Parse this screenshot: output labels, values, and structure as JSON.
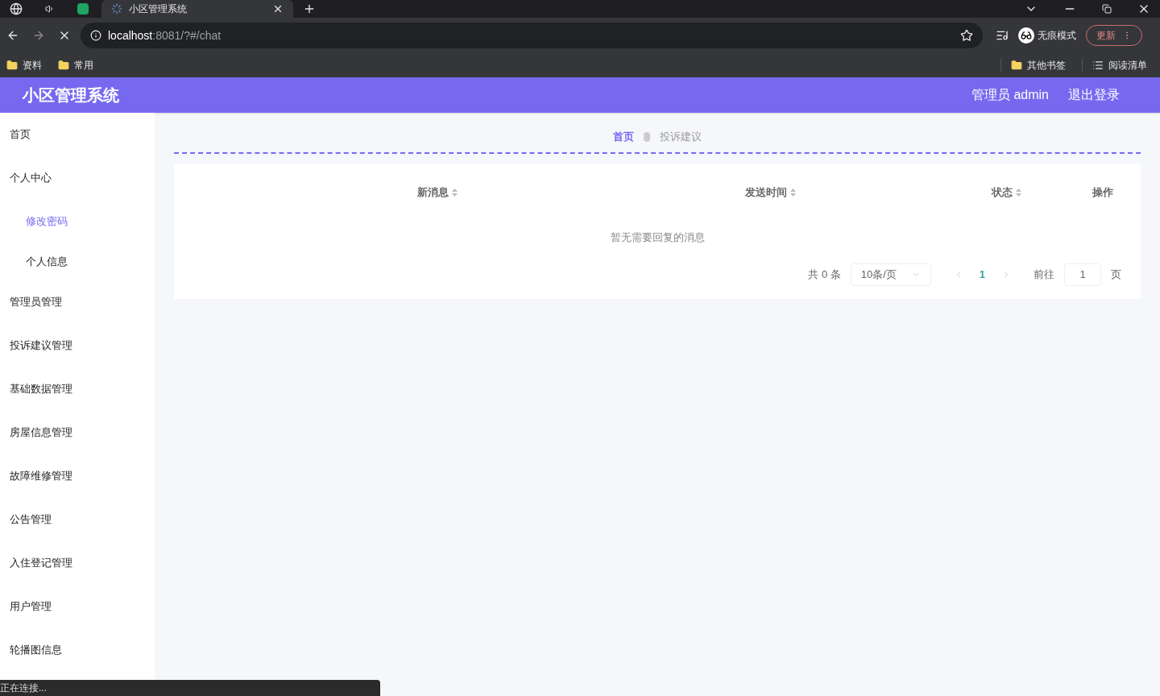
{
  "browser": {
    "tabs": [
      {
        "title": "小区管理系统",
        "selected": true
      }
    ],
    "url_host": "localhost",
    "url_path": ":8081/?#/chat",
    "profile": "无痕模式",
    "update_button": "更新",
    "bookmarks": [
      "资料",
      "常用"
    ],
    "other_bookmarks": "其他书签",
    "reading_list": "阅读清单"
  },
  "header": {
    "title": "小区管理系统",
    "user": "管理员 admin",
    "logout": "退出登录"
  },
  "sidebar": {
    "items": [
      {
        "label": "首页",
        "selected": false
      },
      {
        "label": "个人中心",
        "selected": false,
        "children": [
          {
            "label": "修改密码",
            "selected": true
          },
          {
            "label": "个人信息",
            "selected": false
          }
        ]
      },
      {
        "label": "管理员管理",
        "selected": false
      },
      {
        "label": "投诉建议管理",
        "selected": false
      },
      {
        "label": "基础数据管理",
        "selected": false
      },
      {
        "label": "房屋信息管理",
        "selected": false
      },
      {
        "label": "故障维修管理",
        "selected": false
      },
      {
        "label": "公告管理",
        "selected": false
      },
      {
        "label": "入住登记管理",
        "selected": false
      },
      {
        "label": "用户管理",
        "selected": false
      },
      {
        "label": "轮播图信息",
        "selected": false
      }
    ]
  },
  "breadcrumb": [
    "首页",
    "投诉建议"
  ],
  "table": {
    "columns": [
      {
        "label": "新消息",
        "sortable": true
      },
      {
        "label": "发送时间",
        "sortable": true
      },
      {
        "label": "状态",
        "sortable": true
      },
      {
        "label": "操作",
        "sortable": false
      }
    ],
    "empty_text": "暂无需要回复的消息"
  },
  "pagination": {
    "total": "共 0 条",
    "page_size": "10条/页",
    "pages": [
      {
        "label": "1",
        "selected": true
      }
    ],
    "goto_label": "前往",
    "goto_value": "1",
    "page_suffix": "页"
  },
  "status_bar": "正在连接..."
}
